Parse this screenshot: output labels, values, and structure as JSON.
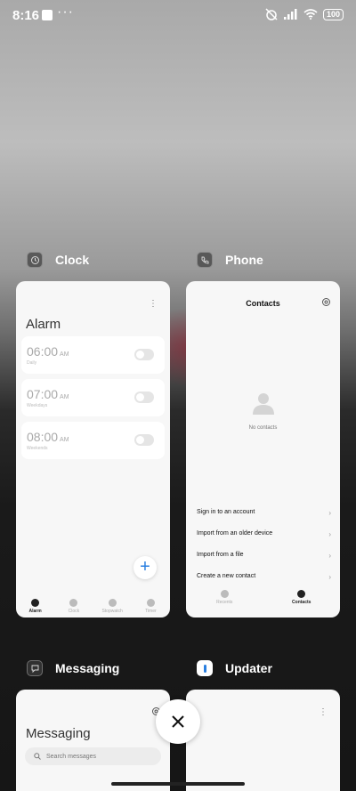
{
  "status_bar": {
    "time": "8:16",
    "more": "···",
    "battery": "100"
  },
  "apps": [
    {
      "name": "Clock",
      "icon": "clock-icon"
    },
    {
      "name": "Phone",
      "icon": "phone-icon"
    },
    {
      "name": "Messaging",
      "icon": "messaging-icon"
    },
    {
      "name": "Updater",
      "icon": "updater-icon"
    }
  ],
  "clock_card": {
    "title": "Alarm",
    "alarms": [
      {
        "time": "06:00",
        "ampm": "AM",
        "label": "Daily"
      },
      {
        "time": "07:00",
        "ampm": "AM",
        "label": "Weekdays"
      },
      {
        "time": "08:00",
        "ampm": "AM",
        "label": "Weekends"
      }
    ],
    "tabs": [
      "Alarm",
      "Clock",
      "Stopwatch",
      "Timer"
    ]
  },
  "phone_card": {
    "title": "Contacts",
    "empty_text": "No contacts",
    "rows": [
      "Sign in to an account",
      "Import from an older device",
      "Import from a file",
      "Create a new contact"
    ],
    "tabs": [
      "Recents",
      "Contacts"
    ]
  },
  "messaging_card": {
    "title": "Messaging",
    "search_placeholder": "Search messages"
  },
  "colors": {
    "accent": "#2a7fe0",
    "card_bg": "#f7f7f7"
  }
}
